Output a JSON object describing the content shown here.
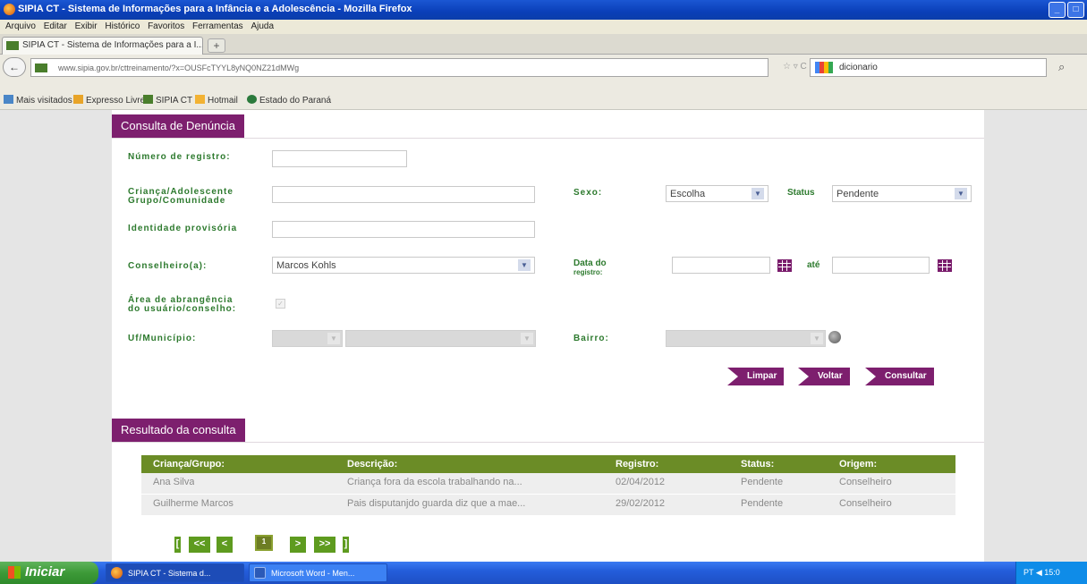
{
  "window": {
    "title": "SIPIA CT - Sistema de Informações para a Infância e a Adolescência - Mozilla Firefox",
    "min_label": "_",
    "max_label": "□"
  },
  "menu": [
    "Arquivo",
    "Editar",
    "Exibir",
    "Histórico",
    "Favoritos",
    "Ferramentas",
    "Ajuda"
  ],
  "tab": {
    "label": "SIPIA CT - Sistema de Informações para a I...",
    "new_tab": "+"
  },
  "nav": {
    "back": "←",
    "url": "www.sipia.gov.br/cttreinamento/?x=OUSFcTYYL8yNQ0NZ21dMWg",
    "url_icons": "☆ ▿ C",
    "search_value": "dicionario",
    "search_icon": "⌕"
  },
  "bookmarks": [
    {
      "label": "Mais visitados",
      "color": "#4a86c7"
    },
    {
      "label": "Expresso Livre",
      "color": "#e8a428"
    },
    {
      "label": "SIPIA CT",
      "color": "#4a7e2c"
    },
    {
      "label": "Hotmail",
      "color": "#f2b233"
    },
    {
      "label": "Estado do Paraná",
      "color": "#2b7a3c"
    }
  ],
  "consulta": {
    "title": "Consulta de Denúncia",
    "numero_label": "Número de registro:",
    "crianca_label_1": "Criança/Adolescente",
    "crianca_label_2": "Grupo/Comunidade",
    "sexo_label": "Sexo:",
    "sexo_value": "Escolha",
    "status_label": "Status",
    "status_value": "Pendente",
    "identidade_label": "Identidade provisória",
    "conselheiro_label": "Conselheiro(a):",
    "conselheiro_value": "Marcos Kohls",
    "data_label_1": "Data do",
    "data_label_2": "registro:",
    "ate_label": "até",
    "area_label_1": "Área de abrangência",
    "area_label_2": "do usuário/conselho:",
    "uf_label": "Uf/Município:",
    "bairro_label": "Bairro:",
    "check_mark": "✓",
    "dropdown_arrow": "▼"
  },
  "buttons": {
    "limpar": "Limpar",
    "voltar": "Voltar",
    "consultar": "Consultar"
  },
  "resultado": {
    "title": "Resultado da consulta",
    "columns": [
      "Criança/Grupo:",
      "Descrição:",
      "Registro:",
      "Status:",
      "Origem:"
    ],
    "rows": [
      [
        "Ana Silva",
        "Criança fora da escola trabalhando na...",
        "02/04/2012",
        "Pendente",
        "Conselheiro"
      ],
      [
        "Guilherme Marcos",
        "Pais disputanjdo guarda diz que a mae...",
        "29/02/2012",
        "Pendente",
        "Conselheiro"
      ]
    ]
  },
  "pager": {
    "first": "<<",
    "prev": "<",
    "current": "1",
    "next": ">",
    "last": ">>",
    "edge_left": "[",
    "edge_right": "]"
  },
  "taskbar": {
    "start": "Iniciar",
    "items": [
      "SIPIA CT - Sistema d...",
      "Microsoft Word - Men..."
    ],
    "tray": "PT  ◀  15:0"
  }
}
